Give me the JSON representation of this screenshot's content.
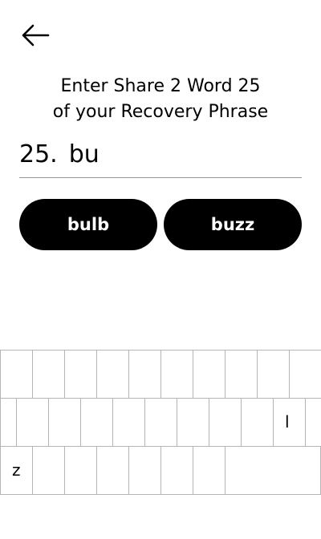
{
  "header": {
    "back_icon": "arrow-left-icon"
  },
  "prompt": {
    "line1": "Enter Share 2 Word 25",
    "line2": "of your Recovery Phrase"
  },
  "input": {
    "number": "25.",
    "value": "bu"
  },
  "suggestions": [
    {
      "label": "bulb"
    },
    {
      "label": "buzz"
    }
  ],
  "keyboard": {
    "row1": [
      "",
      "",
      "",
      "",
      "",
      "",
      "",
      "",
      "",
      ""
    ],
    "row2": [
      "",
      "",
      "",
      "",
      "",
      "",
      "",
      "",
      "l",
      ""
    ],
    "row3": [
      "z",
      "",
      "",
      "",
      "",
      "",
      "",
      ""
    ]
  }
}
